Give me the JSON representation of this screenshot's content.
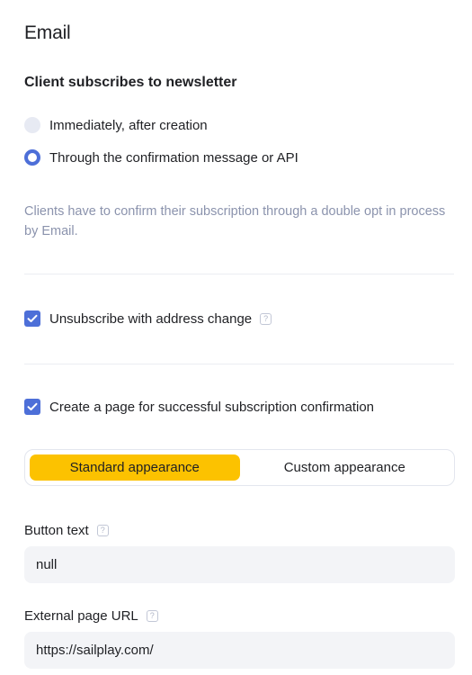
{
  "section": {
    "title": "Email"
  },
  "subscription": {
    "title": "Client subscribes to newsletter",
    "options": [
      {
        "label": "Immediately, after creation",
        "selected": false
      },
      {
        "label": "Through the confirmation message or API",
        "selected": true
      }
    ],
    "hint": "Clients have to confirm their subscription through a double opt in process by Email."
  },
  "unsubscribe": {
    "label": "Unsubscribe with address change",
    "checked": true,
    "help": "?"
  },
  "confirmation_page": {
    "label": "Create a page for successful subscription confirmation",
    "checked": true,
    "appearance_options": [
      "Standard appearance",
      "Custom appearance"
    ],
    "selected_appearance": "Standard appearance"
  },
  "button_text": {
    "label": "Button text",
    "help": "?",
    "value": "null"
  },
  "external_url": {
    "label": "External page URL",
    "help": "?",
    "value": "https://sailplay.com/"
  },
  "colors": {
    "accent": "#4d6fd8",
    "segment_active": "#fcc200",
    "hint": "#8b93ad"
  }
}
